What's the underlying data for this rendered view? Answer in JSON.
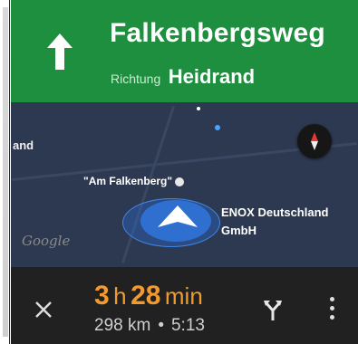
{
  "header": {
    "street": "Falkenbergsweg",
    "direction_label": "Richtung",
    "direction_target": "Heidrand",
    "background_color": "#1e8f3f"
  },
  "map": {
    "label_left": "and",
    "poi_label": "\"Am Falkenberg\"",
    "business_line1": "ENOX Deutschland",
    "business_line2": "GmbH",
    "map_logo": "Google",
    "background_color": "#2d3950"
  },
  "bottom_bar": {
    "duration_hours": "3",
    "hours_unit": "h",
    "duration_minutes": "28",
    "minutes_unit": "min",
    "distance": "298 km",
    "separator": "•",
    "arrival_time": "5:13",
    "eta_color": "#f39a2e"
  },
  "icons": {
    "turn_arrow": "arrow-up-icon",
    "compass": "compass-icon",
    "nav_arrow": "navigation-arrow-icon",
    "close": "close-icon",
    "routes": "alternate-routes-icon",
    "more": "more-vertical-icon"
  }
}
